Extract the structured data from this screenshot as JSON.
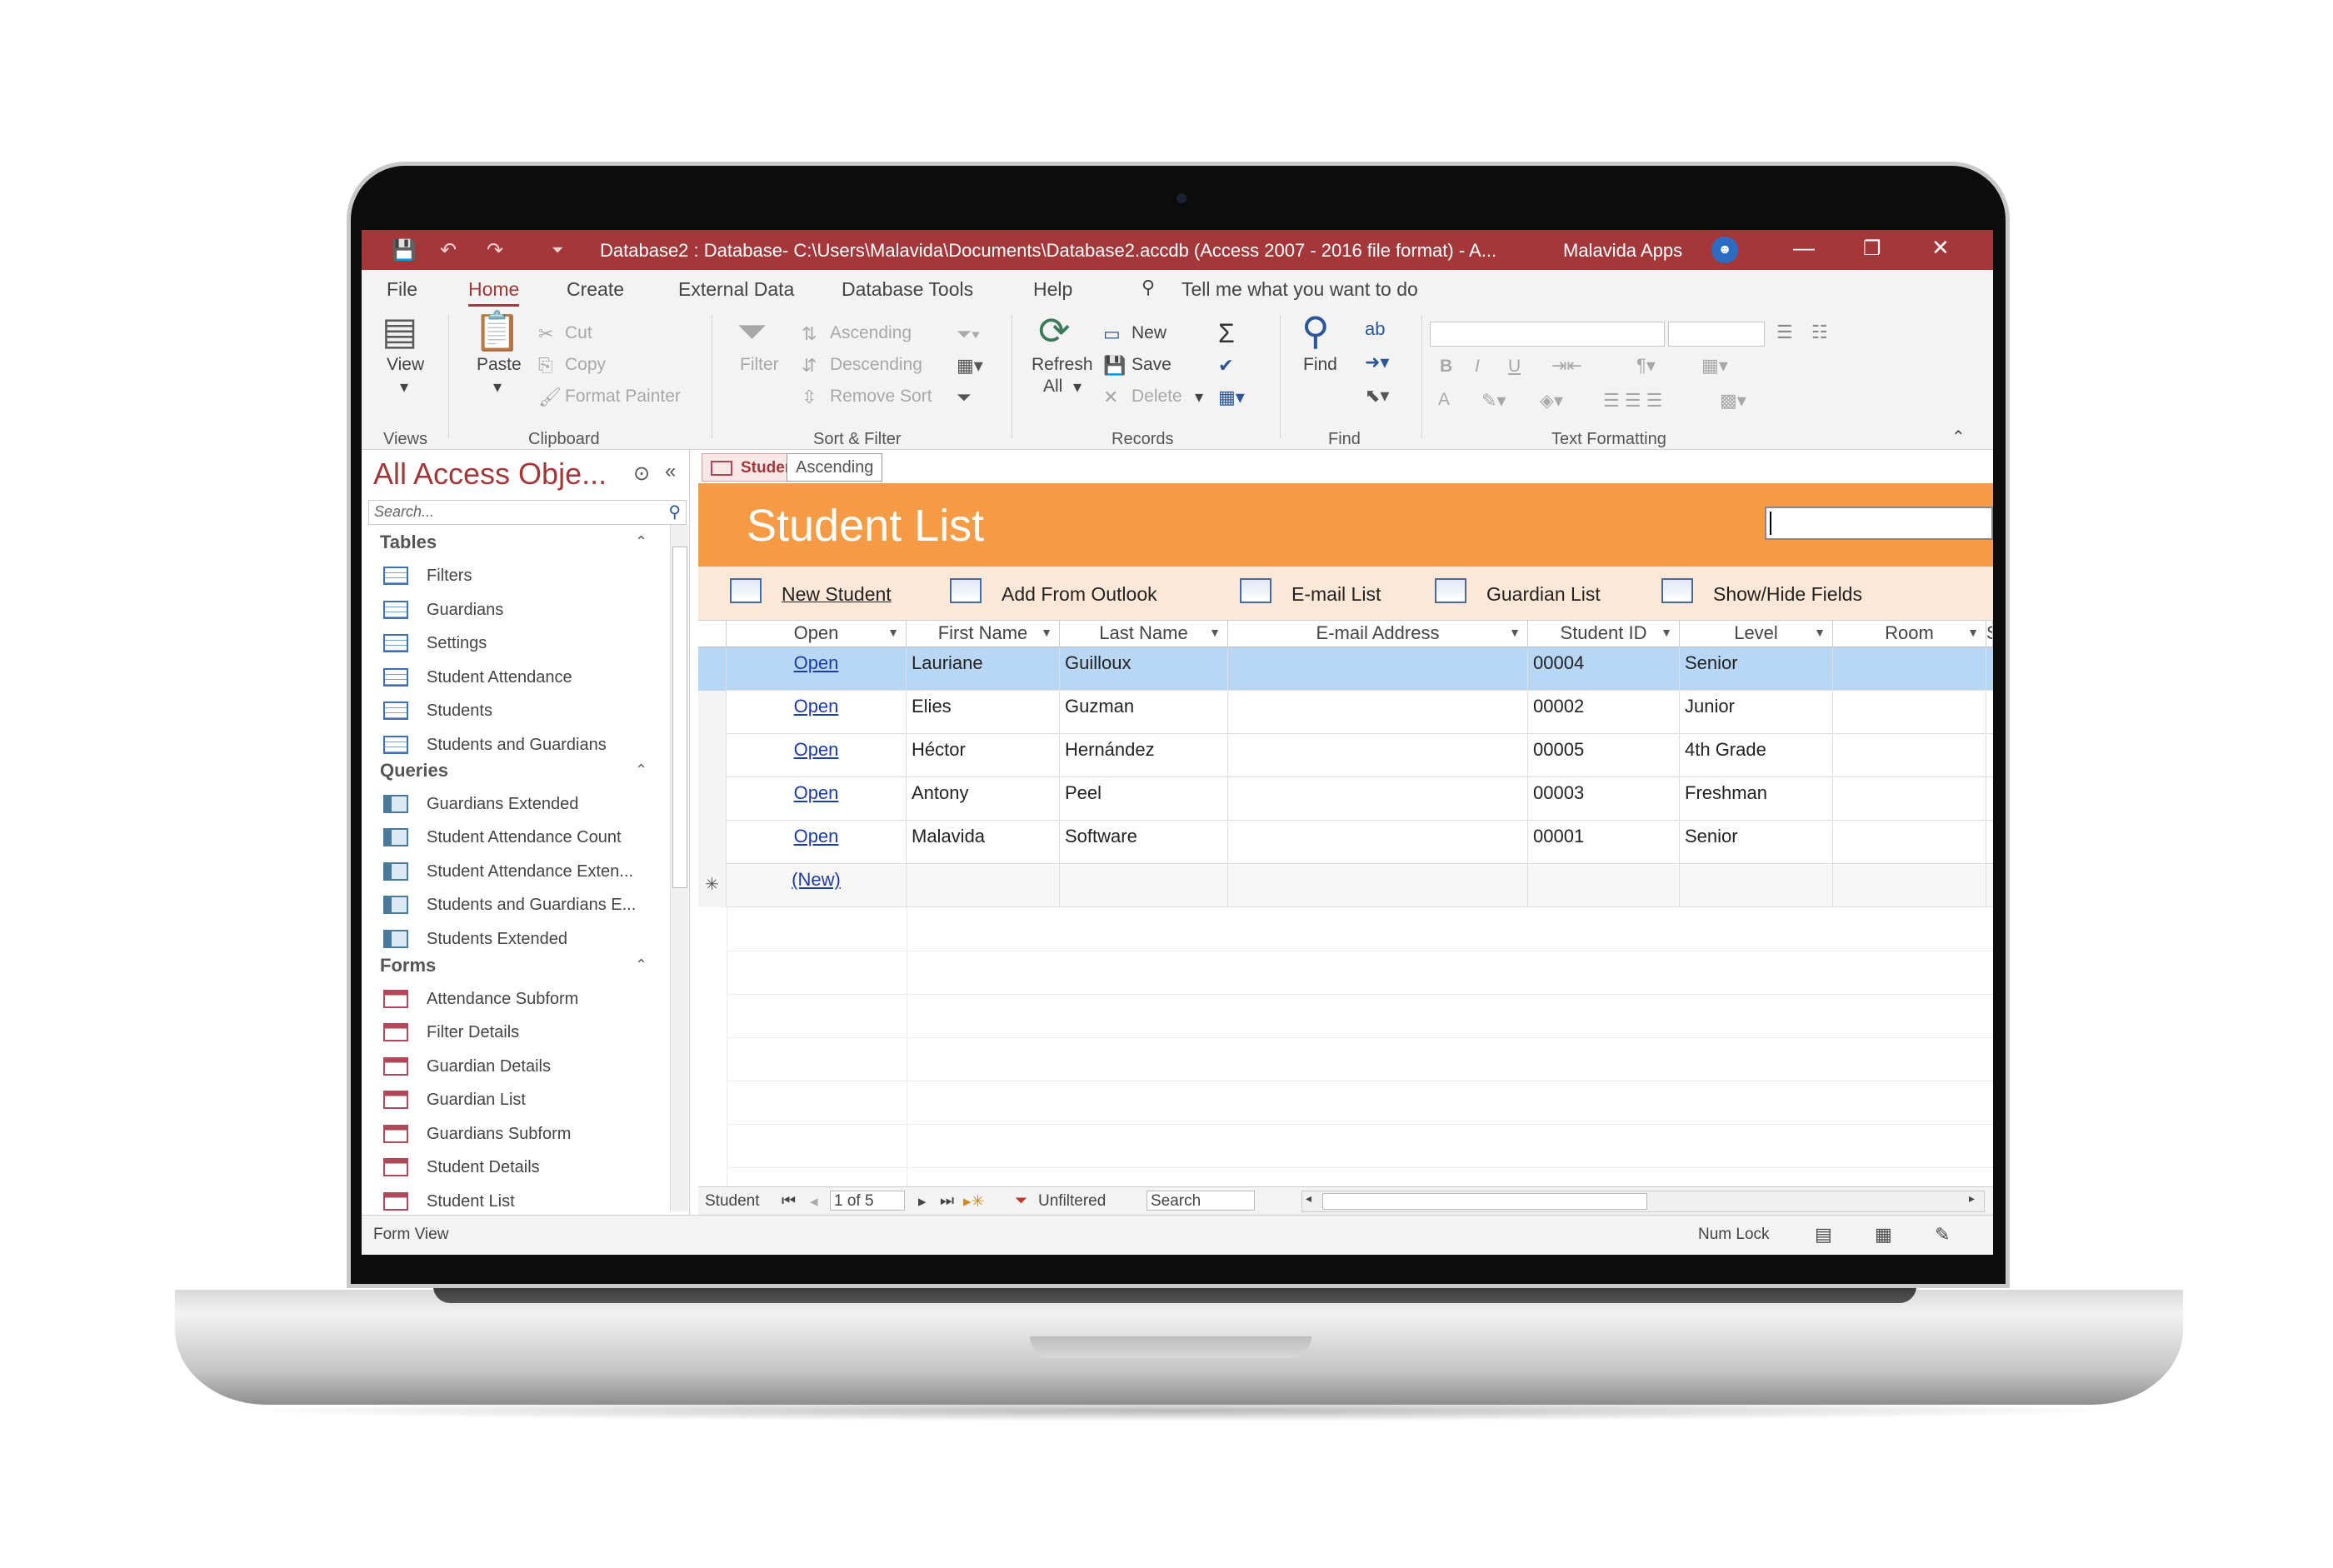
{
  "titlebar": {
    "title": "Database2 : Database- C:\\Users\\Malavida\\Documents\\Database2.accdb (Access 2007 - 2016 file format)  -  A...",
    "user": "Malavida Apps",
    "save_icon": "💾",
    "undo_icon": "↶",
    "redo_icon": "↷",
    "qat_icon": "⏷",
    "minimize_icon": "—",
    "restore_icon": "❐",
    "close_icon": "✕"
  },
  "menu": {
    "items": [
      "File",
      "Home",
      "Create",
      "External Data",
      "Database Tools",
      "Help"
    ],
    "active": "Home",
    "tellme": "Tell me what you want to do"
  },
  "ribbon": {
    "views": {
      "view": "View",
      "group": "Views"
    },
    "clipboard": {
      "paste": "Paste",
      "cut": "Cut",
      "copy": "Copy",
      "format_painter": "Format Painter",
      "group": "Clipboard"
    },
    "sort_filter": {
      "filter": "Filter",
      "ascending": "Ascending",
      "descending": "Descending",
      "remove_sort": "Remove Sort",
      "group": "Sort & Filter"
    },
    "records": {
      "refresh": "Refresh",
      "refresh_all": "All",
      "new": "New",
      "save": "Save",
      "delete": "Delete",
      "group": "Records"
    },
    "find": {
      "find": "Find",
      "group": "Find"
    },
    "text_formatting": {
      "bold": "B",
      "italic": "I",
      "underline": "U",
      "font_color": "A",
      "group": "Text Formatting"
    }
  },
  "nav": {
    "title": "All Access Obje...",
    "search_placeholder": "Search...",
    "sections": [
      {
        "name": "Tables",
        "items": [
          "Filters",
          "Guardians",
          "Settings",
          "Student Attendance",
          "Students",
          "Students and Guardians"
        ]
      },
      {
        "name": "Queries",
        "items": [
          "Guardians Extended",
          "Student Attendance Count",
          "Student Attendance Exten...",
          "Students and Guardians E...",
          "Students Extended"
        ]
      },
      {
        "name": "Forms",
        "items": [
          "Attendance Subform",
          "Filter Details",
          "Guardian Details",
          "Guardian List",
          "Guardians Subform",
          "Student Details",
          "Student List"
        ]
      }
    ]
  },
  "doc": {
    "tab_label": "Student List",
    "tooltip": "Ascending",
    "form_title": "Student List",
    "commands": [
      "New Student",
      "Add From Outlook",
      "E-mail List",
      "Guardian List",
      "Show/Hide Fields"
    ],
    "columns": [
      "Open",
      "First Name",
      "Last Name",
      "E-mail Address",
      "Student ID",
      "Level",
      "Room",
      "Sp"
    ],
    "rows": [
      {
        "open": "Open",
        "first": "Lauriane",
        "last": "Guilloux",
        "email": "",
        "id": "00004",
        "level": "Senior",
        "room": ""
      },
      {
        "open": "Open",
        "first": "Elies",
        "last": "Guzman",
        "email": "",
        "id": "00002",
        "level": "Junior",
        "room": ""
      },
      {
        "open": "Open",
        "first": "Héctor",
        "last": "Hernández",
        "email": "",
        "id": "00005",
        "level": "4th Grade",
        "room": ""
      },
      {
        "open": "Open",
        "first": "Antony",
        "last": "Peel",
        "email": "",
        "id": "00003",
        "level": "Freshman",
        "room": ""
      },
      {
        "open": "Open",
        "first": "Malavida",
        "last": "Software",
        "email": "",
        "id": "00001",
        "level": "Senior",
        "room": ""
      }
    ],
    "new_row": "(New)",
    "new_row_marker": "✳",
    "recnav": {
      "label": "Student",
      "position": "1 of 5",
      "filter": "Unfiltered",
      "search": "Search"
    }
  },
  "status": {
    "view": "Form View",
    "numlock": "Num Lock"
  }
}
